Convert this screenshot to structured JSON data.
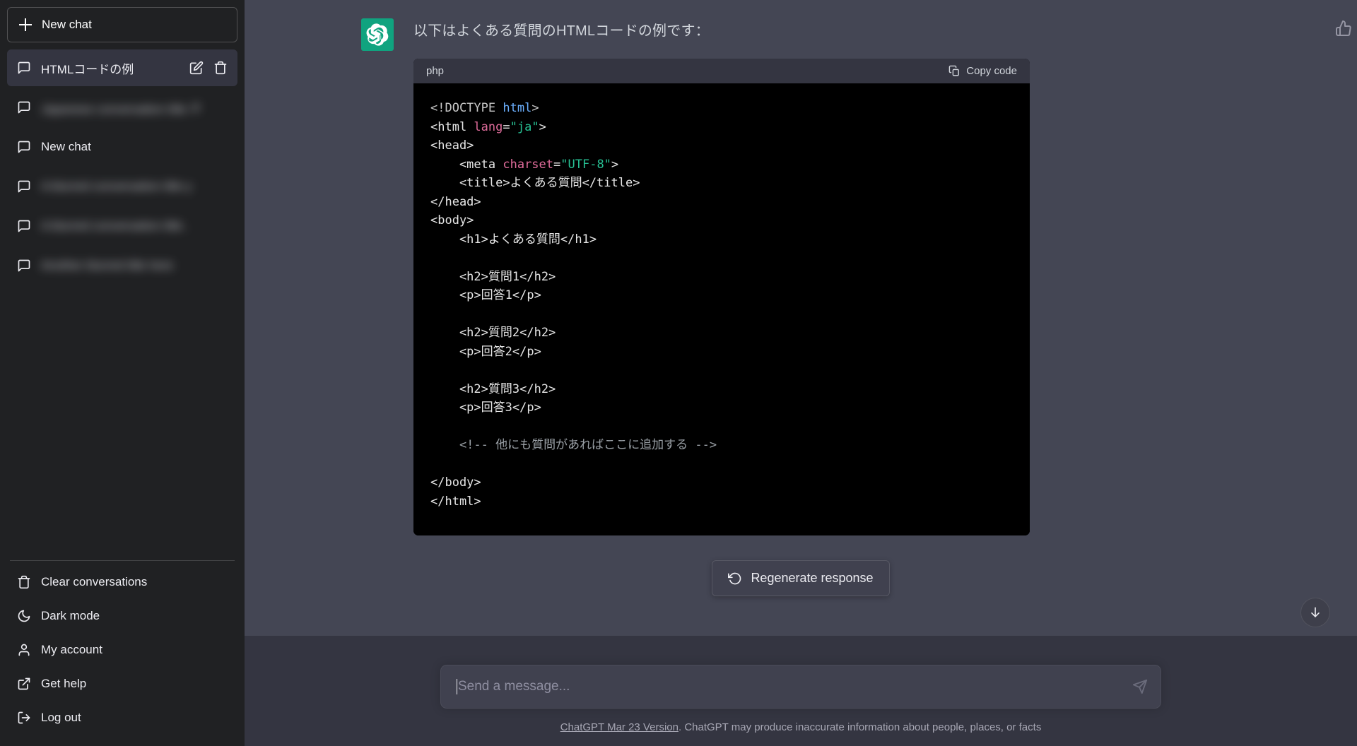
{
  "sidebar": {
    "new_chat_label": "New chat",
    "conversations": [
      {
        "label": "HTMLコードの例",
        "active": true,
        "blurred": false
      },
      {
        "label": "Japanese conversation title チ",
        "active": false,
        "blurred": true
      },
      {
        "label": "New chat",
        "active": false,
        "blurred": false
      },
      {
        "label": "A blurred conversation title y",
        "active": false,
        "blurred": true
      },
      {
        "label": "A blurred conversation title .",
        "active": false,
        "blurred": true
      },
      {
        "label": "Another blurred title here",
        "active": false,
        "blurred": true
      }
    ],
    "menu": [
      {
        "label": "Clear conversations",
        "icon": "trash-icon"
      },
      {
        "label": "Dark mode",
        "icon": "moon-icon"
      },
      {
        "label": "My account",
        "icon": "user-icon"
      },
      {
        "label": "Get help",
        "icon": "external-link-icon"
      },
      {
        "label": "Log out",
        "icon": "logout-icon"
      }
    ]
  },
  "message": {
    "text": "以下はよくある質問のHTMLコードの例です：",
    "code": {
      "language": "php",
      "copy_label": "Copy code",
      "lines": [
        [
          {
            "t": "<!DOCTYPE ",
            "c": "tok-dim"
          },
          {
            "t": "html",
            "c": "tok-name"
          },
          {
            "t": ">",
            "c": "tok-dim"
          }
        ],
        [
          {
            "t": "<html ",
            "c": "tok-tag"
          },
          {
            "t": "lang",
            "c": "tok-attr"
          },
          {
            "t": "=",
            "c": "tok-tag"
          },
          {
            "t": "\"ja\"",
            "c": "tok-str"
          },
          {
            "t": ">",
            "c": "tok-tag"
          }
        ],
        [
          {
            "t": "<head>",
            "c": "tok-tag"
          }
        ],
        [
          {
            "t": "    <meta ",
            "c": "tok-tag"
          },
          {
            "t": "charset",
            "c": "tok-attr"
          },
          {
            "t": "=",
            "c": "tok-tag"
          },
          {
            "t": "\"UTF-8\"",
            "c": "tok-str"
          },
          {
            "t": ">",
            "c": "tok-tag"
          }
        ],
        [
          {
            "t": "    <title>よくある質問</title>",
            "c": "tok-tag"
          }
        ],
        [
          {
            "t": "</head>",
            "c": "tok-tag"
          }
        ],
        [
          {
            "t": "<body>",
            "c": "tok-tag"
          }
        ],
        [
          {
            "t": "    <h1>よくある質問</h1>",
            "c": "tok-tag"
          }
        ],
        [
          {
            "t": "",
            "c": "tok-tag"
          }
        ],
        [
          {
            "t": "    <h2>質問1</h2>",
            "c": "tok-tag"
          }
        ],
        [
          {
            "t": "    <p>回答1</p>",
            "c": "tok-tag"
          }
        ],
        [
          {
            "t": "",
            "c": "tok-tag"
          }
        ],
        [
          {
            "t": "    <h2>質問2</h2>",
            "c": "tok-tag"
          }
        ],
        [
          {
            "t": "    <p>回答2</p>",
            "c": "tok-tag"
          }
        ],
        [
          {
            "t": "",
            "c": "tok-tag"
          }
        ],
        [
          {
            "t": "    <h2>質問3</h2>",
            "c": "tok-tag"
          }
        ],
        [
          {
            "t": "    <p>回答3</p>",
            "c": "tok-tag"
          }
        ],
        [
          {
            "t": "",
            "c": "tok-tag"
          }
        ],
        [
          {
            "t": "    <!-- 他にも質問があればここに追加する -->",
            "c": "tok-com"
          }
        ],
        [
          {
            "t": "",
            "c": "tok-tag"
          }
        ],
        [
          {
            "t": "</body>",
            "c": "tok-tag"
          }
        ],
        [
          {
            "t": "</html>",
            "c": "tok-tag"
          }
        ]
      ]
    }
  },
  "actions": {
    "regenerate_label": "Regenerate response"
  },
  "composer": {
    "value": "",
    "placeholder": "Send a message..."
  },
  "footer": {
    "link_text": "ChatGPT Mar 23 Version",
    "rest_text": ". ChatGPT may produce inaccurate information about people, places, or facts"
  },
  "colors": {
    "accent_green": "#10a37f",
    "sidebar_bg": "#202123",
    "main_bg": "#343541",
    "assistant_bg": "#444654",
    "code_bg": "#000000"
  }
}
